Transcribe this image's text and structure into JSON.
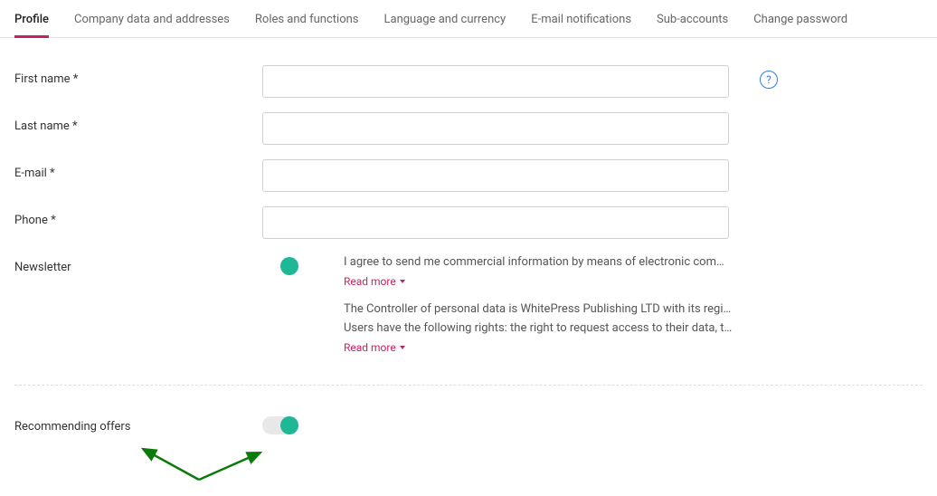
{
  "tabs": [
    {
      "label": "Profile",
      "active": true
    },
    {
      "label": "Company data and addresses",
      "active": false
    },
    {
      "label": "Roles and functions",
      "active": false
    },
    {
      "label": "Language and currency",
      "active": false
    },
    {
      "label": "E-mail notifications",
      "active": false
    },
    {
      "label": "Sub-accounts",
      "active": false
    },
    {
      "label": "Change password",
      "active": false
    }
  ],
  "form": {
    "first_name": {
      "label": "First name *",
      "value": ""
    },
    "last_name": {
      "label": "Last name *",
      "value": ""
    },
    "email": {
      "label": "E-mail *",
      "value": ""
    },
    "phone": {
      "label": "Phone *",
      "value": ""
    },
    "newsletter": {
      "label": "Newsletter",
      "on": true,
      "consent_text": "I agree to send me commercial information by means of electronic communica...",
      "read_more": "Read more",
      "controller_text1": "The Controller of personal data is WhitePress Publishing LTD  with its registere...",
      "controller_text2": "Users have the following rights: the right to request access to their data, the rig...",
      "read_more2": "Read more"
    },
    "recommending": {
      "label": "Recommending offers",
      "on": true
    }
  },
  "help_icon_name": "question-circle-icon"
}
